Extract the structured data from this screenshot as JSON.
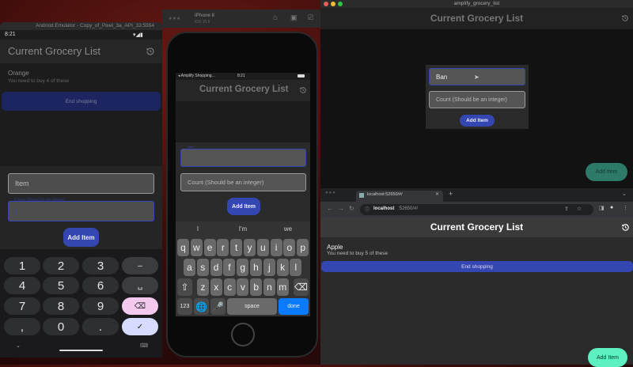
{
  "android": {
    "window_title": "Android Emulator - Copy_of_Pixel_3a_API_33:5554",
    "time": "8:21",
    "app_title": "Current Grocery List",
    "item_name": "Orange",
    "item_sub": "You need to buy 4 of these",
    "end_button": "End shopping",
    "item_placeholder": "Item",
    "count_label": "Count (Should be an integer)",
    "add_button": "Add Item",
    "keys": [
      "1",
      "2",
      "3",
      "–",
      "4",
      "5",
      "6",
      "␣",
      "7",
      "8",
      "9",
      "⌫",
      ",",
      "0",
      ".",
      "✓"
    ]
  },
  "iphone": {
    "sim_name": "iPhone 8",
    "sim_os": "iOS 15.5",
    "back_app": "◂ Amplify Shopping...",
    "time": "8:21",
    "app_title": "Current Grocery List",
    "item_label": "Item",
    "count_placeholder": "Count (Should be an integer)",
    "add_button": "Add Item",
    "suggestions": [
      "I",
      "I'm",
      "we"
    ],
    "row1": [
      "q",
      "w",
      "e",
      "r",
      "t",
      "y",
      "u",
      "i",
      "o",
      "p"
    ],
    "row2": [
      "a",
      "s",
      "d",
      "f",
      "g",
      "h",
      "j",
      "k",
      "l"
    ],
    "row3": [
      "z",
      "x",
      "c",
      "v",
      "b",
      "n",
      "m"
    ],
    "num_key": "123",
    "space_key": "space",
    "done_key": "done"
  },
  "mac": {
    "window_title": "amplify_grocery_list",
    "app_title": "Current Grocery List",
    "item_value": "Ban",
    "count_placeholder": "Count (Should be an integer)",
    "add_button": "Add Item",
    "fab": "Add Item"
  },
  "chrome": {
    "tab_title": "localhost:52650/#/",
    "url_host": "localhost",
    "url_rest": ":52650/#/",
    "app_title": "Current Grocery List",
    "item_name": "Apple",
    "item_sub": "You need to buy 5 of these",
    "end_button": "End shopping",
    "fab": "Add Item"
  },
  "colors": {
    "accent": "#3446b2",
    "fab_mac": "#2e7a68",
    "fab_web": "#5ef0c0",
    "ios_done": "#0a7aff"
  }
}
